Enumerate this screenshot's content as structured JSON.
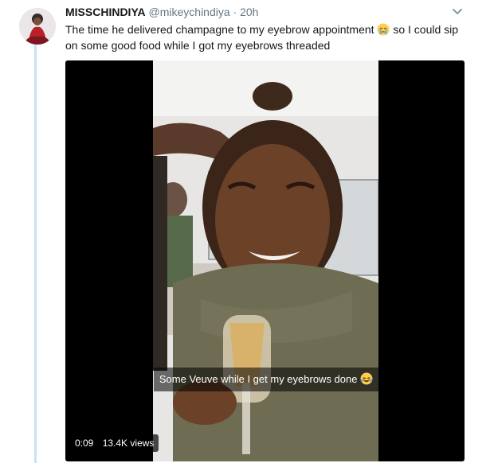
{
  "tweet": {
    "display_name": "MISSCHINDIYA",
    "handle": "@mikeychindiya",
    "separator": "·",
    "time": "20h",
    "text_part1": "The time he delivered champagne to my eyebrow appointment",
    "text_part2": "so I could sip on some good food while I got my eyebrows threaded",
    "emoji_icon": "crying-face-icon",
    "menu_icon": "chevron-down-icon"
  },
  "video": {
    "caption_text": "Some Veuve while I get my eyebrows done",
    "caption_emoji_icon": "laughing-face-icon",
    "duration": "0:09",
    "views": "13.4K views"
  },
  "colors": {
    "thread_line": "#c4e4f7",
    "secondary_text": "#657786",
    "primary_text": "#14171a"
  }
}
